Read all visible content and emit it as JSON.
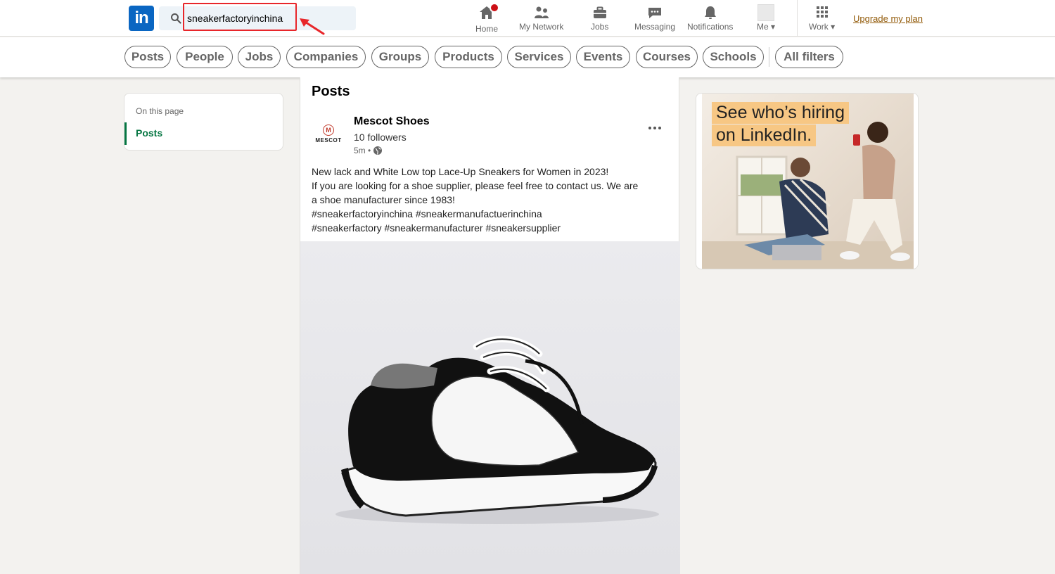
{
  "nav": {
    "search_value": "sneakerfactoryinchina",
    "items": [
      {
        "label": "Home",
        "icon": "home-icon"
      },
      {
        "label": "My Network",
        "icon": "network-icon"
      },
      {
        "label": "Jobs",
        "icon": "briefcase-icon"
      },
      {
        "label": "Messaging",
        "icon": "messaging-icon"
      },
      {
        "label": "Notifications",
        "icon": "bell-icon"
      },
      {
        "label": "Me ▾",
        "icon": "avatar"
      },
      {
        "label": "Work ▾",
        "icon": "grid-icon"
      }
    ],
    "upgrade": "Upgrade my plan"
  },
  "filters": [
    "Posts",
    "People",
    "Jobs",
    "Companies",
    "Groups",
    "Products",
    "Services",
    "Events",
    "Courses",
    "Schools",
    "All filters"
  ],
  "left": {
    "subtitle": "On this page",
    "link": "Posts"
  },
  "main": {
    "title": "Posts",
    "post": {
      "author": "Mescot Shoes",
      "avatar_letter": "M",
      "avatar_brand": "MESCOT",
      "followers": "10 followers",
      "time": "5m •",
      "lines": [
        "New lack and White Low top Lace-Up Sneakers for Women in 2023!",
        "If you are looking for a shoe supplier, please feel free to contact us. We are",
        "a shoe manufacturer since 1983!",
        "#sneakerfactoryinchina #sneakermanufactuerinchina",
        "#sneakerfactory #sneakermanufacturer #sneakersupplier"
      ]
    }
  },
  "ad": {
    "line1": "See who’s hiring",
    "line2": "on LinkedIn."
  },
  "colors": {
    "brand": "#0a66c2",
    "accent_green": "#057642",
    "highlight_red": "#e8262a",
    "ad_highlight": "#f7c784"
  }
}
